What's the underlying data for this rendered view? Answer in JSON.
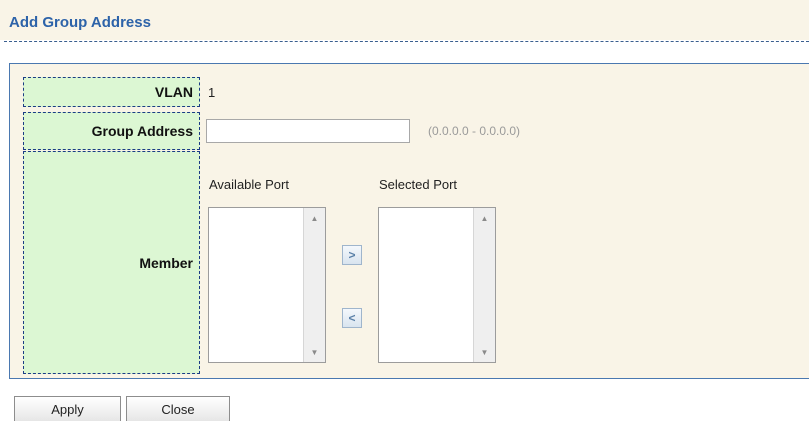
{
  "header": {
    "title": "Add Group Address"
  },
  "form": {
    "vlan": {
      "label": "VLAN",
      "value": "1"
    },
    "group_address": {
      "label": "Group Address",
      "value": "",
      "hint": "(0.0.0.0 - 0.0.0.0)"
    },
    "member": {
      "label": "Member",
      "available_title": "Available Port",
      "selected_title": "Selected Port",
      "available_items": [],
      "selected_items": [],
      "add_symbol": ">",
      "remove_symbol": "<"
    }
  },
  "buttons": {
    "apply": "Apply",
    "close": "Close"
  }
}
